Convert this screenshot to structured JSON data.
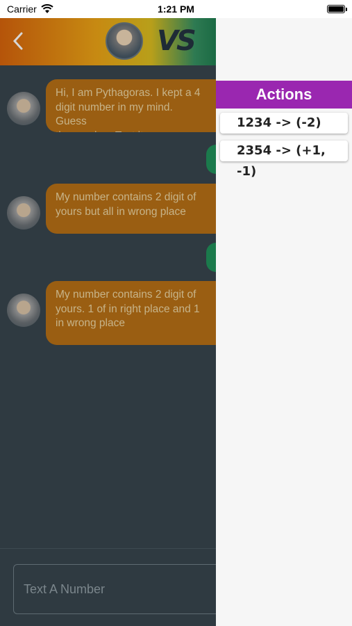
{
  "status_bar": {
    "carrier": "Carrier",
    "time": "1:21 PM"
  },
  "header": {
    "back_icon": "chevron-left-icon",
    "vs_label": "VS"
  },
  "messages": [
    {
      "from": "bot",
      "text": "Hi, I am Pythagoras. I kept a 4\ndigit number in my mind. Guess\nthe number. Text it..."
    },
    {
      "from": "user"
    },
    {
      "from": "bot",
      "text": "My number contains 2 digit of\nyours but all in wrong place"
    },
    {
      "from": "user"
    },
    {
      "from": "bot",
      "text": "My number contains 2 digit of\nyours. 1 of in right place and 1\nin wrong place"
    }
  ],
  "input": {
    "placeholder": "Text A Number"
  },
  "drawer": {
    "title": "Actions",
    "actions": [
      {
        "label": "1234 -> (-2)"
      },
      {
        "label": "2354 -> (+1, -1)"
      }
    ]
  },
  "colors": {
    "accent_purple": "#9a27b0",
    "bubble_orange": "#9a5e12",
    "user_green": "#1b7a4c",
    "background": "#2f3a41"
  }
}
